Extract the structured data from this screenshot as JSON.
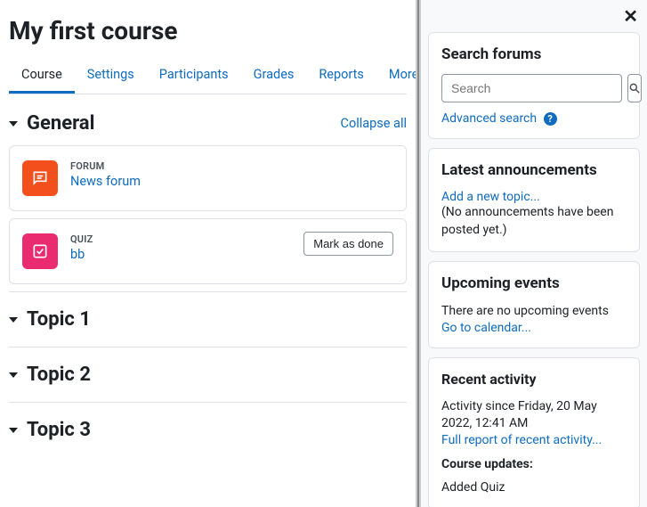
{
  "page": {
    "title": "My first course"
  },
  "tabs": {
    "course": "Course",
    "settings": "Settings",
    "participants": "Participants",
    "grades": "Grades",
    "reports": "Reports",
    "more": "More"
  },
  "general": {
    "title": "General",
    "collapse": "Collapse all"
  },
  "activities": {
    "forum": {
      "type": "FORUM",
      "name": "News forum"
    },
    "quiz": {
      "type": "QUIZ",
      "name": "bb",
      "mark_done": "Mark as done"
    }
  },
  "topics": {
    "t1": "Topic 1",
    "t2": "Topic 2",
    "t3": "Topic 3"
  },
  "search": {
    "title": "Search forums",
    "placeholder": "Search",
    "advanced": "Advanced search"
  },
  "announcements": {
    "title": "Latest announcements",
    "add": "Add a new topic...",
    "none": "(No announcements have been posted yet.)"
  },
  "events": {
    "title": "Upcoming events",
    "none": "There are no upcoming events",
    "calendar": "Go to calendar..."
  },
  "activity": {
    "title": "Recent activity",
    "since": "Activity since Friday, 20 May 2022, 12:41 AM",
    "full_report": "Full report of recent activity...",
    "updates_label": "Course updates:",
    "added": "Added Quiz"
  }
}
